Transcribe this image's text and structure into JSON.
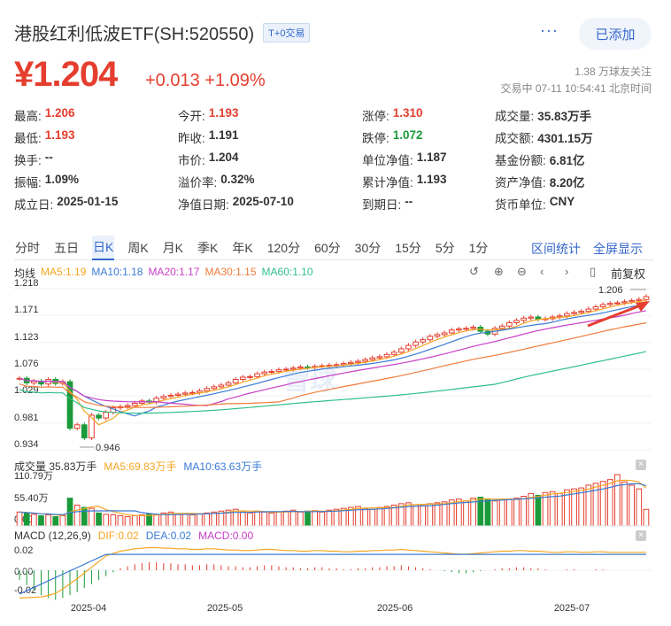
{
  "header": {
    "title": "港股红利低波ETF(SH:520550)",
    "badge": "T+0交易",
    "more_icon": "more-dots-icon",
    "add_label": "已添加"
  },
  "quote": {
    "price": "¥1.204",
    "change": "+0.013",
    "change_pct": "+1.09%",
    "followers": "1.38 万球友关注",
    "status_time": "交易中 07-11 10:54:41 北京时间",
    "color_up": "#e53e2f",
    "color_down": "#1b9a3a"
  },
  "stats": [
    [
      {
        "k": "最高:",
        "v": "1.206",
        "c": "red"
      },
      {
        "k": "今开:",
        "v": "1.193",
        "c": "red"
      },
      {
        "k": "涨停:",
        "v": "1.310",
        "c": "red"
      },
      {
        "k": "成交量:",
        "v": "35.83万手",
        "c": ""
      }
    ],
    [
      {
        "k": "最低:",
        "v": "1.193",
        "c": "red"
      },
      {
        "k": "昨收:",
        "v": "1.191",
        "c": ""
      },
      {
        "k": "跌停:",
        "v": "1.072",
        "c": "green"
      },
      {
        "k": "成交额:",
        "v": "4301.15万",
        "c": ""
      }
    ],
    [
      {
        "k": "换手:",
        "v": "--",
        "c": ""
      },
      {
        "k": "市价:",
        "v": "1.204",
        "c": ""
      },
      {
        "k": "单位净值:",
        "v": "1.187",
        "c": ""
      },
      {
        "k": "基金份额:",
        "v": "6.81亿",
        "c": ""
      }
    ],
    [
      {
        "k": "振幅:",
        "v": "1.09%",
        "c": ""
      },
      {
        "k": "溢价率:",
        "v": "0.32%",
        "c": ""
      },
      {
        "k": "累计净值:",
        "v": "1.193",
        "c": ""
      },
      {
        "k": "资产净值:",
        "v": "8.20亿",
        "c": ""
      }
    ],
    [
      {
        "k": "成立日:",
        "v": "2025-01-15",
        "c": ""
      },
      {
        "k": "净值日期:",
        "v": "2025-07-10",
        "c": ""
      },
      {
        "k": "到期日:",
        "v": "--",
        "c": ""
      },
      {
        "k": "货币单位:",
        "v": "CNY",
        "c": ""
      }
    ]
  ],
  "tabs": {
    "items": [
      "分时",
      "五日",
      "日K",
      "周K",
      "月K",
      "季K",
      "年K",
      "120分",
      "60分",
      "30分",
      "15分",
      "5分",
      "1分"
    ],
    "active": "日K",
    "range_stats": "区间统计",
    "fullscreen": "全屏显示"
  },
  "ma": {
    "mode": "均线",
    "ma5": "MA5:1.19",
    "ma10": "MA10:1.18",
    "ma20": "MA20:1.17",
    "ma30": "MA30:1.15",
    "ma60": "MA60:1.10",
    "adjust": "前复权",
    "colors": {
      "ma5": "#f5a623",
      "ma10": "#3a7bd5",
      "ma20": "#c83fc8",
      "ma30": "#f07c3c",
      "ma60": "#2fbf8a"
    }
  },
  "volume": {
    "label": "成交量 35.83万手",
    "ma5": "MA5:69.83万手",
    "ma10": "MA10:63.63万手",
    "ticks": [
      "110.79万",
      "55.40万",
      "0.00"
    ]
  },
  "macd": {
    "label": "MACD (12,26,9)",
    "dif": "DIF:0.02",
    "dea": "DEA:0.02",
    "macd": "MACD:0.00",
    "ticks": [
      "0.02",
      "0.00",
      "-0.02"
    ]
  },
  "chart_data": {
    "type": "candlestick",
    "y_ticks": [
      "1.218",
      "1.171",
      "1.123",
      "1.076",
      "1.029",
      "0.981",
      "0.934"
    ],
    "ylim": [
      0.934,
      1.218
    ],
    "x_ticks": [
      "2025-04",
      "2025-05",
      "2025-06",
      "2025-07"
    ],
    "annotations": {
      "high": "1.206",
      "low": "0.946"
    },
    "watermark": "雪球",
    "closes": [
      1.06,
      1.052,
      1.055,
      1.05,
      1.058,
      1.051,
      1.054,
      0.972,
      0.978,
      0.955,
      0.995,
      0.99,
      1.0,
      1.008,
      1.01,
      1.012,
      1.016,
      1.02,
      1.018,
      1.025,
      1.028,
      1.03,
      1.032,
      1.034,
      1.035,
      1.038,
      1.042,
      1.045,
      1.048,
      1.052,
      1.058,
      1.062,
      1.063,
      1.068,
      1.071,
      1.072,
      1.075,
      1.076,
      1.078,
      1.08,
      1.079,
      1.081,
      1.082,
      1.083,
      1.084,
      1.086,
      1.088,
      1.09,
      1.093,
      1.096,
      1.098,
      1.102,
      1.106,
      1.112,
      1.118,
      1.124,
      1.128,
      1.134,
      1.137,
      1.14,
      1.145,
      1.147,
      1.148,
      1.15,
      1.143,
      1.138,
      1.148,
      1.152,
      1.158,
      1.162,
      1.166,
      1.168,
      1.164,
      1.165,
      1.168,
      1.17,
      1.174,
      1.176,
      1.178,
      1.182,
      1.186,
      1.19,
      1.192,
      1.193,
      1.195,
      1.197,
      1.199,
      1.204
    ],
    "volumes": [
      30,
      28,
      25,
      22,
      24,
      20,
      22,
      60,
      45,
      40,
      38,
      28,
      25,
      24,
      22,
      20,
      22,
      24,
      26,
      25,
      28,
      30,
      26,
      27,
      24,
      26,
      28,
      30,
      32,
      34,
      36,
      30,
      28,
      32,
      30,
      28,
      30,
      32,
      34,
      30,
      32,
      33,
      30,
      34,
      36,
      38,
      40,
      42,
      38,
      36,
      40,
      42,
      45,
      48,
      50,
      46,
      44,
      48,
      50,
      52,
      56,
      58,
      54,
      60,
      62,
      58,
      54,
      56,
      58,
      60,
      64,
      70,
      66,
      72,
      74,
      70,
      78,
      80,
      82,
      88,
      92,
      96,
      100,
      110.79,
      95,
      88,
      80,
      35.83
    ],
    "macd_bars": [
      -0.01,
      -0.015,
      -0.02,
      -0.025,
      -0.028,
      -0.03,
      -0.028,
      -0.025,
      -0.022,
      -0.018,
      -0.014,
      -0.01,
      -0.006,
      -0.002,
      0.002,
      0.004,
      0.006,
      0.007,
      0.008,
      0.008,
      0.007,
      0.007,
      0.006,
      0.006,
      0.005,
      0.005,
      0.006,
      0.006,
      0.005,
      0.004,
      0.004,
      0.003,
      0.003,
      0.004,
      0.005,
      0.005,
      0.004,
      0.003,
      0.003,
      0.002,
      0.002,
      0.003,
      0.003,
      0.002,
      0.002,
      0.001,
      0.001,
      0.002,
      0.002,
      0.003,
      0.003,
      0.004,
      0.004,
      0.005,
      0.004,
      0.003,
      0.002,
      0.001,
      0.0,
      -0.001,
      -0.002,
      -0.003,
      -0.003,
      -0.002,
      -0.001,
      0.0,
      0.001,
      0.002,
      0.002,
      0.003,
      0.003,
      0.002,
      0.002,
      0.001,
      0.0,
      0.0,
      0.001,
      0.001,
      0.0,
      0.0,
      0.001,
      0.001,
      0.0,
      0.0,
      0.0,
      0.0,
      0.0,
      0.0
    ]
  }
}
